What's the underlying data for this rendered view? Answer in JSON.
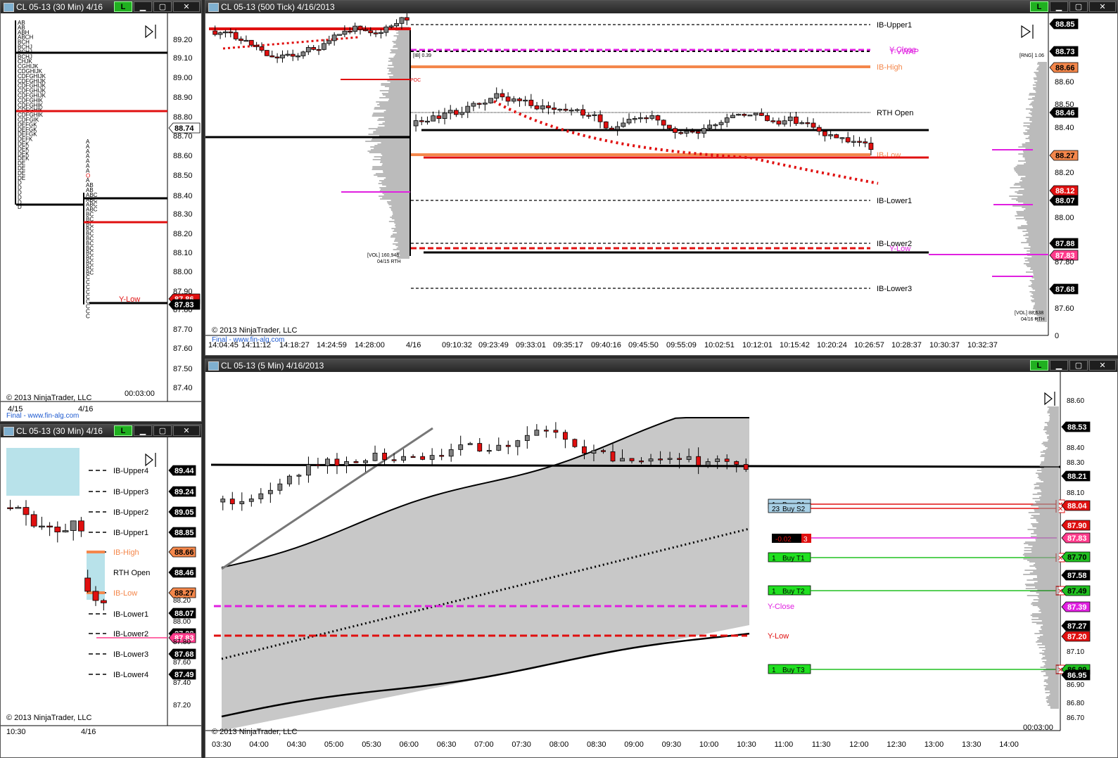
{
  "windows": {
    "w1": {
      "title": "CL 05-13 (30 Min)  4/16",
      "copyright": "© 2013 NinjaTrader, LLC",
      "clock": "00:03:00",
      "x_labels": [
        "4/15",
        "4/16"
      ],
      "watermark": "Final - www.fin-alg.com"
    },
    "w2": {
      "title": "CL 05-13 (500 Tick)  4/16/2013",
      "copyright": "© 2013 NinjaTrader, LLC",
      "watermark": "Final - www.fin-alg.com",
      "x_labels": [
        "14:04:45",
        "14:11:12",
        "14:18:27",
        "14:24:59",
        "14:28:00",
        "4/16",
        "09:10:32",
        "09:23:49",
        "09:33:01",
        "09:35:17",
        "09:40:16",
        "09:45:50",
        "09:55:09",
        "10:02:51",
        "10:12:01",
        "10:15:42",
        "10:20:24",
        "10:26:57",
        "10:28:37",
        "10:30:37",
        "10:32:37"
      ],
      "vol_left": "[VOL] 160,948",
      "vol_left_date": "04/15 RTH",
      "vol_right": "[VOL] 88,638",
      "vol_right_date": "04/16 RTH",
      "ib_label": "[IB] 0.39",
      "rng_label": "[RNG] 1.06",
      "poc_label": "POC",
      "level_labels": {
        "ib_upper1": "IB-Upper1",
        "y_close": "Y-Close",
        "y_vwap": "Y-VWAP",
        "ib_high": "IB-High",
        "rth_open": "RTH Open",
        "ib_low": "IB-Low",
        "ib_lower1": "IB-Lower1",
        "ib_lower2": "IB-Lower2",
        "y_low": "Y-Low",
        "ib_lower3": "IB-Lower3"
      }
    },
    "w3": {
      "title": "CL 05-13 (30 Min)  4/16",
      "copyright": "© 2013 NinjaTrader, LLC",
      "x_labels": [
        "10:30",
        "4/16"
      ],
      "levels": [
        "IB-Upper4",
        "IB-Upper3",
        "IB-Upper2",
        "IB-Upper1",
        "IB-High",
        "RTH Open",
        "IB-Low",
        "IB-Lower1",
        "IB-Lower2",
        "IB-Lower3",
        "IB-Lower4"
      ]
    },
    "w4": {
      "title": "CL 05-13 (5 Min)  4/16/2013",
      "copyright": "© 2013 NinjaTrader, LLC",
      "clock": "00:03:00",
      "x_labels": [
        "03:30",
        "04:00",
        "04:30",
        "05:00",
        "05:30",
        "06:00",
        "06:30",
        "07:00",
        "07:30",
        "08:00",
        "08:30",
        "09:00",
        "09:30",
        "10:00",
        "10:30",
        "11:00",
        "11:30",
        "12:00",
        "12:30",
        "13:00",
        "13:30",
        "14:00"
      ],
      "orders": [
        {
          "qty": "1",
          "label": "Buy S1"
        },
        {
          "qty": "23",
          "label": "Buy S2"
        },
        {
          "qty": "1",
          "label": "Buy T1"
        },
        {
          "qty": "1",
          "label": "Buy T2"
        },
        {
          "qty": "1",
          "label": "Buy T3"
        }
      ],
      "pnl": "-0.02",
      "pnl_qty": "3",
      "y_close": "Y-Close",
      "y_low": "Y-Low"
    }
  },
  "tpo_rows": [
    "AB",
    "AB",
    "ABH",
    "ABCH",
    "BCH",
    "BCHJ",
    "BCHJ",
    "BCHJ",
    "CHJK",
    "CGHIJK",
    "CDGHIJK",
    "CDFGHIJK",
    "CDFGHIJK",
    "CDFGHIJK",
    "CDFGHIJK",
    "CDFGHIJK",
    "CDFGHIK",
    "CDFGHIK",
    "CDFGHIK",
    "CDFGHIK",
    "CDFGIK",
    "DEFGK",
    "DEFGK",
    "DEFGK",
    "DEFK",
    "DEK",
    "DEK",
    "DEK",
    "DEK",
    "DE",
    "DE",
    "DE",
    "DE",
    "D",
    "D",
    "D",
    "D",
    "D",
    "D"
  ],
  "tpo_rows2": [
    "A",
    "A",
    "A",
    "A",
    "A",
    "A",
    "A",
    "O",
    "A",
    "AB",
    "AB",
    "ABC",
    "ABC",
    "ABC",
    "ABC",
    "BC",
    "BC",
    "BC",
    "BC",
    "BC",
    "BC",
    "BC",
    "BC",
    "BC",
    "BC",
    "BC",
    "BC",
    "BC",
    "C",
    "C",
    "C",
    "C",
    "C",
    "C",
    "C",
    "C",
    "C"
  ],
  "axis": {
    "w1": [
      "89.20",
      "89.10",
      "89.00",
      "88.90",
      "88.80",
      "88.74",
      "88.70",
      "88.60",
      "88.50",
      "88.40",
      "88.30",
      "88.20",
      "88.10",
      "88.00",
      "87.90",
      "87.80",
      "87.70",
      "87.60",
      "87.50",
      "87.40"
    ],
    "w2": [
      "88.85",
      "88.73",
      "88.66",
      "88.60",
      "88.50",
      "88.46",
      "88.40",
      "88.27",
      "88.20",
      "88.12",
      "88.07",
      "88.00",
      "87.88",
      "87.83",
      "87.80",
      "87.68",
      "87.60",
      "0"
    ],
    "w3": [
      "89.44",
      "89.24",
      "89.05",
      "88.85",
      "88.66",
      "88.46",
      "88.27",
      "88.20",
      "88.07",
      "88.00",
      "87.88",
      "87.83",
      "87.80",
      "87.68",
      "87.60",
      "87.49",
      "87.40",
      "87.20"
    ],
    "w4": [
      "88.60",
      "88.53",
      "88.40",
      "88.30",
      "88.21",
      "88.10",
      "88.04",
      "87.90",
      "87.83",
      "87.70",
      "87.58",
      "87.49",
      "87.39",
      "87.27",
      "87.20",
      "87.10",
      "86.99",
      "86.95",
      "86.90",
      "86.80",
      "86.70"
    ]
  },
  "colors": {
    "up": "#808080",
    "down": "#e01010",
    "ib_high": "#f4874b",
    "y_close": "#e020e0",
    "y_low": "#e01010"
  }
}
